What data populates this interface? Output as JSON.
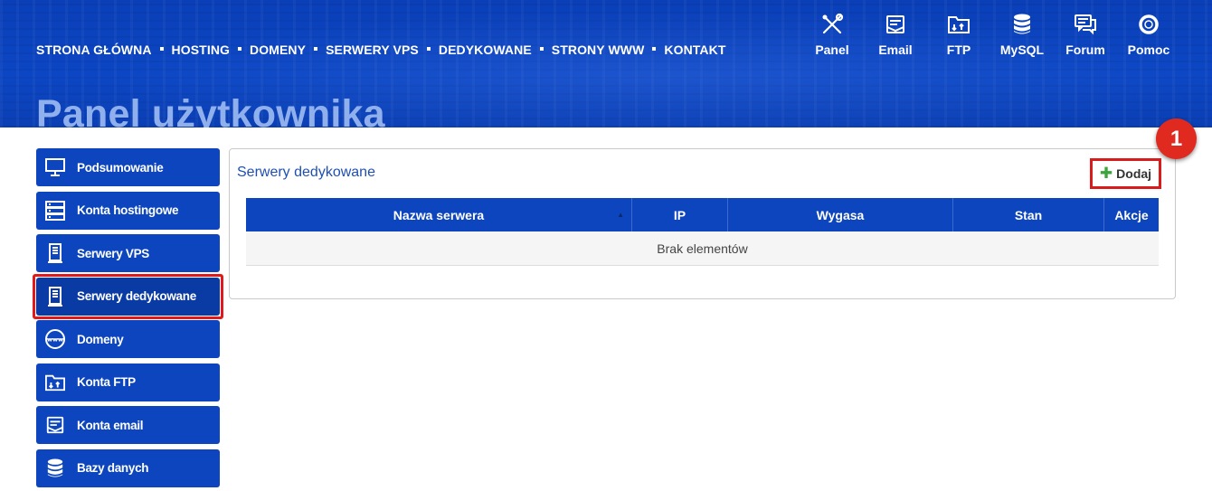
{
  "nav": {
    "items": [
      "STRONA GŁÓWNA",
      "HOSTING",
      "DOMENY",
      "SERWERY VPS",
      "DEDYKOWANE",
      "STRONY WWW",
      "KONTAKT"
    ]
  },
  "tools": [
    {
      "label": "Panel",
      "icon": "tools-icon"
    },
    {
      "label": "Email",
      "icon": "email-icon"
    },
    {
      "label": "FTP",
      "icon": "folder-icon"
    },
    {
      "label": "MySQL",
      "icon": "database-icon"
    },
    {
      "label": "Forum",
      "icon": "forum-icon"
    },
    {
      "label": "Pomoc",
      "icon": "lifebuoy-icon"
    }
  ],
  "page_title": "Panel użytkownika",
  "sidebar": {
    "items": [
      {
        "label": "Podsumowanie",
        "icon": "monitor-icon"
      },
      {
        "label": "Konta hostingowe",
        "icon": "server-rack-icon"
      },
      {
        "label": "Serwery VPS",
        "icon": "server-icon"
      },
      {
        "label": "Serwery dedykowane",
        "icon": "server-icon",
        "active": true
      },
      {
        "label": "Domeny",
        "icon": "globe-www-icon"
      },
      {
        "label": "Konta FTP",
        "icon": "folder-icon"
      },
      {
        "label": "Konta email",
        "icon": "email-icon"
      },
      {
        "label": "Bazy danych",
        "icon": "database-icon"
      }
    ]
  },
  "main": {
    "title": "Serwery dedykowane",
    "add_button": "Dodaj",
    "marker": "1",
    "table": {
      "columns": [
        "Nazwa serwera",
        "IP",
        "Wygasa",
        "Stan",
        "Akcje"
      ],
      "empty_text": "Brak elementów"
    }
  },
  "colors": {
    "brand_blue": "#0c45bd",
    "highlight_red": "#e01a1a",
    "title_light_blue": "#8fb0ec"
  }
}
